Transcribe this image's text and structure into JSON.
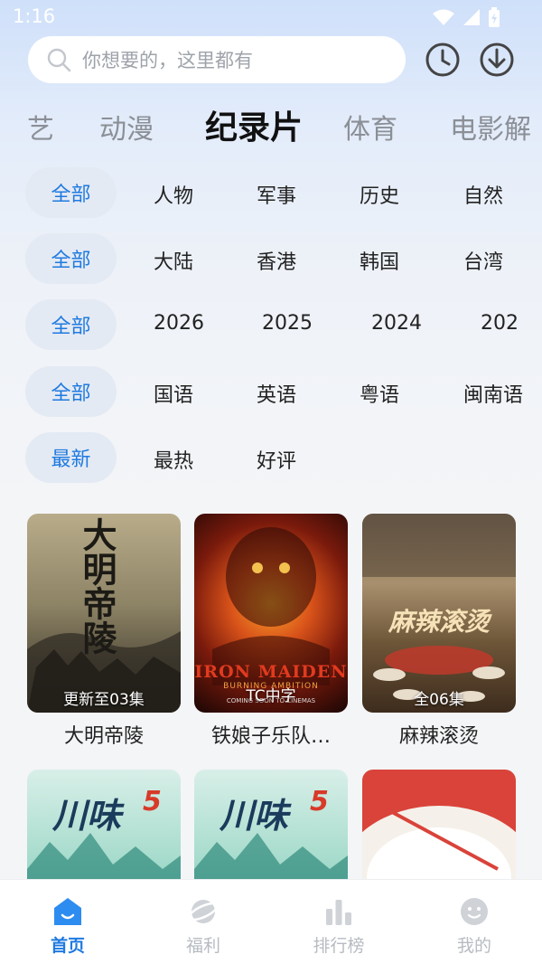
{
  "status_bar": {
    "time": "1:16"
  },
  "search": {
    "placeholder": "你想要的，这里都有"
  },
  "category_tabs": [
    {
      "label": "艺"
    },
    {
      "label": "动漫"
    },
    {
      "label": "纪录片",
      "active": true
    },
    {
      "label": "体育"
    },
    {
      "label": "电影解"
    }
  ],
  "filters": {
    "genre": {
      "chip": "全部",
      "options": [
        "人物",
        "军事",
        "历史",
        "自然"
      ]
    },
    "region": {
      "chip": "全部",
      "options": [
        "大陆",
        "香港",
        "韩国",
        "台湾"
      ]
    },
    "year": {
      "chip": "全部",
      "options": [
        "2026",
        "2025",
        "2024",
        "202"
      ]
    },
    "language": {
      "chip": "全部",
      "options": [
        "国语",
        "英语",
        "粤语",
        "闽南语"
      ]
    },
    "sort": {
      "chip": "最新",
      "options": [
        "最热",
        "好评"
      ]
    }
  },
  "videos": [
    {
      "title": "大明帝陵",
      "badge": "更新至03集",
      "poster_text": "大明帝陵"
    },
    {
      "title": "铁娘子乐队…",
      "badge": "TC中字",
      "poster_text": "IRON MAIDEN",
      "poster_subtext": "BURNING AMBITION",
      "poster_small": "COMING SOON TO CINEMAS"
    },
    {
      "title": "麻辣滚烫",
      "badge": "全06集",
      "poster_text": "麻辣滚烫"
    },
    {
      "title": "",
      "badge": "",
      "poster_text": "川味",
      "poster_number": "5"
    },
    {
      "title": "",
      "badge": "",
      "poster_text": "川味",
      "poster_number": "5"
    },
    {
      "title": "",
      "badge": "",
      "poster_text": ""
    }
  ],
  "bottom_nav": [
    {
      "label": "首页",
      "icon": "home-icon",
      "active": true
    },
    {
      "label": "福利",
      "icon": "planet-icon"
    },
    {
      "label": "排行榜",
      "icon": "ranking-icon"
    },
    {
      "label": "我的",
      "icon": "profile-icon"
    }
  ],
  "colors": {
    "accent": "#1f7ae0",
    "chip_bg": "#e4eaf3",
    "inactive": "#b7bbc1"
  }
}
